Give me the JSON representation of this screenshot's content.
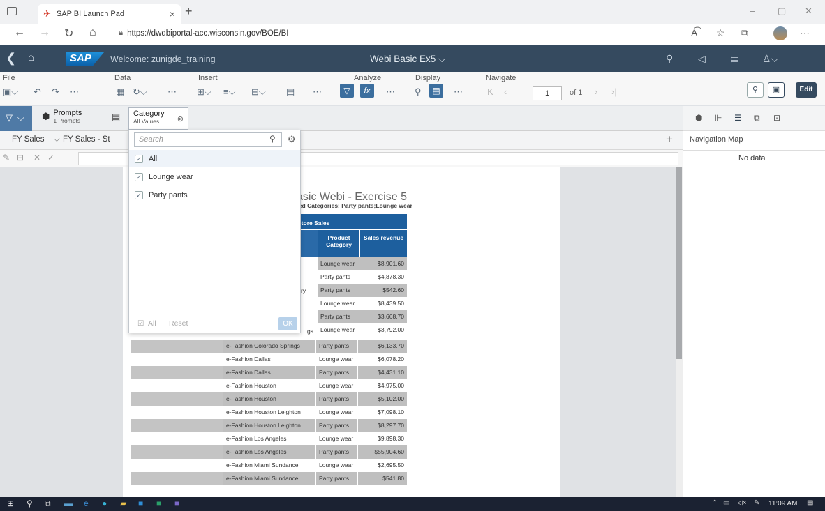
{
  "browser": {
    "tab_title": "SAP BI Launch Pad",
    "tab_close": "×",
    "new_tab": "+",
    "url": "https://dwdbiportal-acc.wisconsin.gov/BOE/BI",
    "win_min": "–",
    "win_max": "▢",
    "win_close": "✕"
  },
  "shell": {
    "welcome": "Welcome: zunigde_training",
    "doc_title": "Webi Basic Ex5 ⌵",
    "logo": "SAP"
  },
  "toolbar": {
    "groups": {
      "file": "File",
      "data": "Data",
      "insert": "Insert",
      "analyze": "Analyze",
      "display": "Display",
      "navigate": "Navigate"
    },
    "page_number": "1",
    "page_of": "of 1",
    "edit_label": "Edit"
  },
  "filterbar": {
    "prompts_title": "Prompts",
    "prompts_sub": "1 Prompts",
    "category_title": "Category",
    "category_sub": "All Values"
  },
  "report_tabs": [
    "FY Sales",
    "FY Sales - St"
  ],
  "report": {
    "title": "asic Webi - Exercise 5",
    "subtitle": "ted Categories: Party pants;Lounge wear",
    "table_header": "Store Sales",
    "col_category": "Product Category",
    "col_revenue": "Sales revenue",
    "fragment_row3": "ry",
    "fragment_row6": "gs",
    "partial_rows": [
      {
        "category": "Lounge wear",
        "revenue": "$8,901.60",
        "alt": true
      },
      {
        "category": "Party pants",
        "revenue": "$4,878.30",
        "alt": false
      },
      {
        "category": "Party pants",
        "revenue": "$542.60",
        "alt": true
      },
      {
        "category": "Lounge wear",
        "revenue": "$8,439.50",
        "alt": false
      },
      {
        "category": "Party pants",
        "revenue": "$3,668.70",
        "alt": true
      },
      {
        "category": "Lounge wear",
        "revenue": "$3,792.00",
        "alt": false
      }
    ],
    "rows": [
      {
        "store": "e-Fashion Colorado Springs",
        "category": "Party pants",
        "revenue": "$6,133.70",
        "alt": true
      },
      {
        "store": "e-Fashion Dallas",
        "category": "Lounge wear",
        "revenue": "$6,078.20",
        "alt": false
      },
      {
        "store": "e-Fashion Dallas",
        "category": "Party pants",
        "revenue": "$4,431.10",
        "alt": true
      },
      {
        "store": "e-Fashion Houston",
        "category": "Lounge wear",
        "revenue": "$4,975.00",
        "alt": false
      },
      {
        "store": "e-Fashion Houston",
        "category": "Party pants",
        "revenue": "$5,102.00",
        "alt": true
      },
      {
        "store": "e-Fashion Houston Leighton",
        "category": "Lounge wear",
        "revenue": "$7,098.10",
        "alt": false
      },
      {
        "store": "e-Fashion Houston Leighton",
        "category": "Party pants",
        "revenue": "$8,297.70",
        "alt": true
      },
      {
        "store": "e-Fashion Los Angeles",
        "category": "Lounge wear",
        "revenue": "$9,898.30",
        "alt": false
      },
      {
        "store": "e-Fashion Los Angeles",
        "category": "Party pants",
        "revenue": "$55,904.60",
        "alt": true
      },
      {
        "store": "e-Fashion Miami Sundance",
        "category": "Lounge wear",
        "revenue": "$2,695.50",
        "alt": false
      },
      {
        "store": "e-Fashion Miami Sundance",
        "category": "Party pants",
        "revenue": "$541.80",
        "alt": true
      }
    ]
  },
  "popup": {
    "search_placeholder": "Search",
    "options": [
      {
        "label": "All",
        "checked": true
      },
      {
        "label": "Lounge wear",
        "checked": true
      },
      {
        "label": "Party pants",
        "checked": true
      }
    ],
    "footer_all": "All",
    "footer_reset": "Reset",
    "ok_label": "OK"
  },
  "right_panel": {
    "title": "Navigation Map",
    "empty": "No data"
  },
  "taskbar": {
    "time": "11:09 AM"
  },
  "colors": {
    "shell": "#354a5f",
    "header_blue": "#1d5f9e",
    "alt_row": "#bfbfbf",
    "filter_button": "#4f7aa6"
  }
}
